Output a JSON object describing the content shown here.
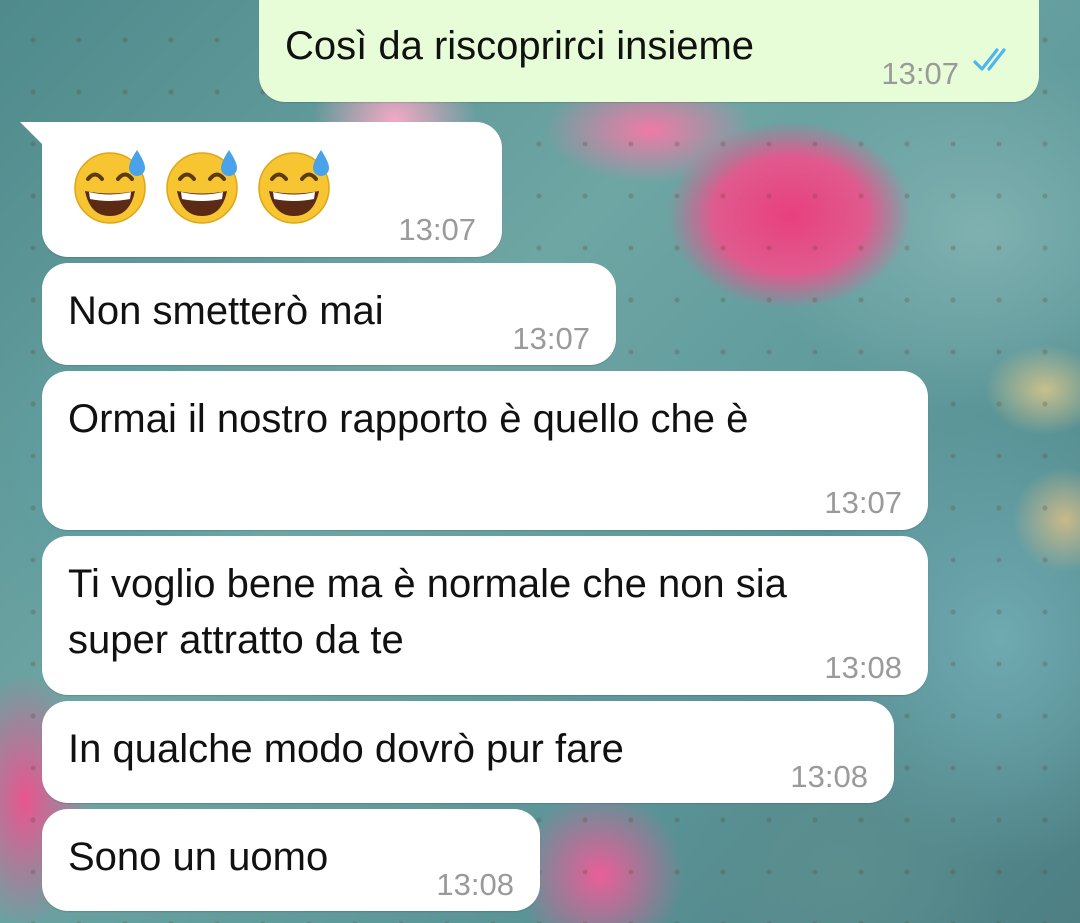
{
  "chat": {
    "messages": [
      {
        "direction": "outgoing",
        "text": "Così da riscoprirci insieme",
        "time": "13:07",
        "status": "read-double-check-blue"
      },
      {
        "direction": "incoming",
        "text": "😅😅😅",
        "time": "13:07"
      },
      {
        "direction": "incoming",
        "text": "Non smetterò mai",
        "time": "13:07"
      },
      {
        "direction": "incoming",
        "text": "Ormai il nostro rapporto è quello che è",
        "time": "13:07"
      },
      {
        "direction": "incoming",
        "text": "Ti voglio bene ma è normale che non sia super attratto da te",
        "time": "13:08"
      },
      {
        "direction": "incoming",
        "text": "In qualche modo dovrò pur fare",
        "time": "13:08"
      },
      {
        "direction": "incoming",
        "text": "Sono un uomo",
        "time": "13:08"
      }
    ]
  },
  "colors": {
    "outgoing_bubble": "#e7fdd7",
    "incoming_bubble": "#ffffff",
    "read_ticks": "#4fb6ec",
    "timestamp": "#9a9a9a"
  },
  "icons": {
    "emoji": "grinning-face-with-sweat-emoji",
    "read_receipt": "double-check-icon"
  }
}
